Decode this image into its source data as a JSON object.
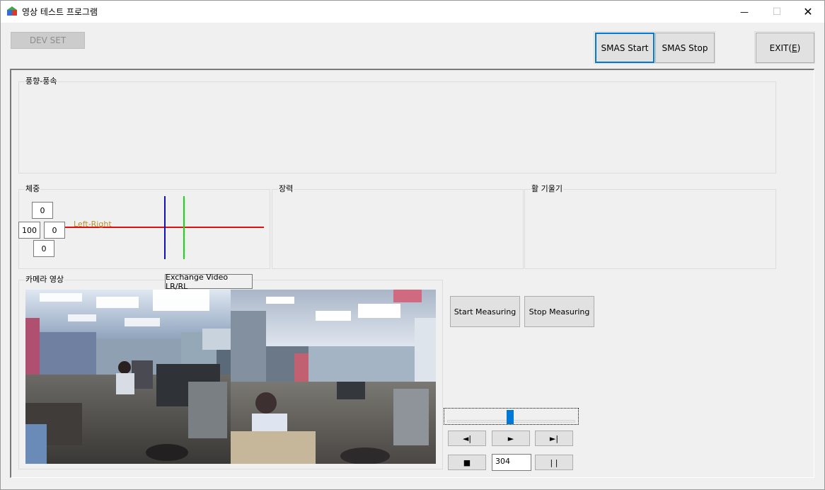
{
  "window": {
    "title": "영상 테스트 프로그램",
    "minimize": "—",
    "maximize": "☐",
    "close": "✕"
  },
  "toolbar": {
    "dev_set": "DEV SET",
    "smas_start": "SMAS Start",
    "smas_stop": "SMAS Stop",
    "exit": "EXIT(E)"
  },
  "groups": {
    "wind": "풍향-풍속",
    "weight": "체중",
    "tension": "장력",
    "bow_tilt": "활 기울기",
    "camera": "카메라 영상"
  },
  "weight_values": {
    "top": "0",
    "left": "100",
    "middle": "0",
    "bottom": "0",
    "overlay_label": "Left-Right"
  },
  "camera": {
    "exchange_tooltip": "Exchange Video LR/RL"
  },
  "measure": {
    "start": "Start Measuring",
    "stop": "Stop Measuring"
  },
  "playback": {
    "prev": "◄|",
    "play": "►",
    "next": "►|",
    "stop": "■",
    "frame": "304",
    "pause": "| |",
    "slider_position": 0.49
  },
  "colors": {
    "accent": "#0078d7",
    "red_line": "#e01010",
    "blue_line": "#1010c0",
    "green_line": "#10e010"
  }
}
